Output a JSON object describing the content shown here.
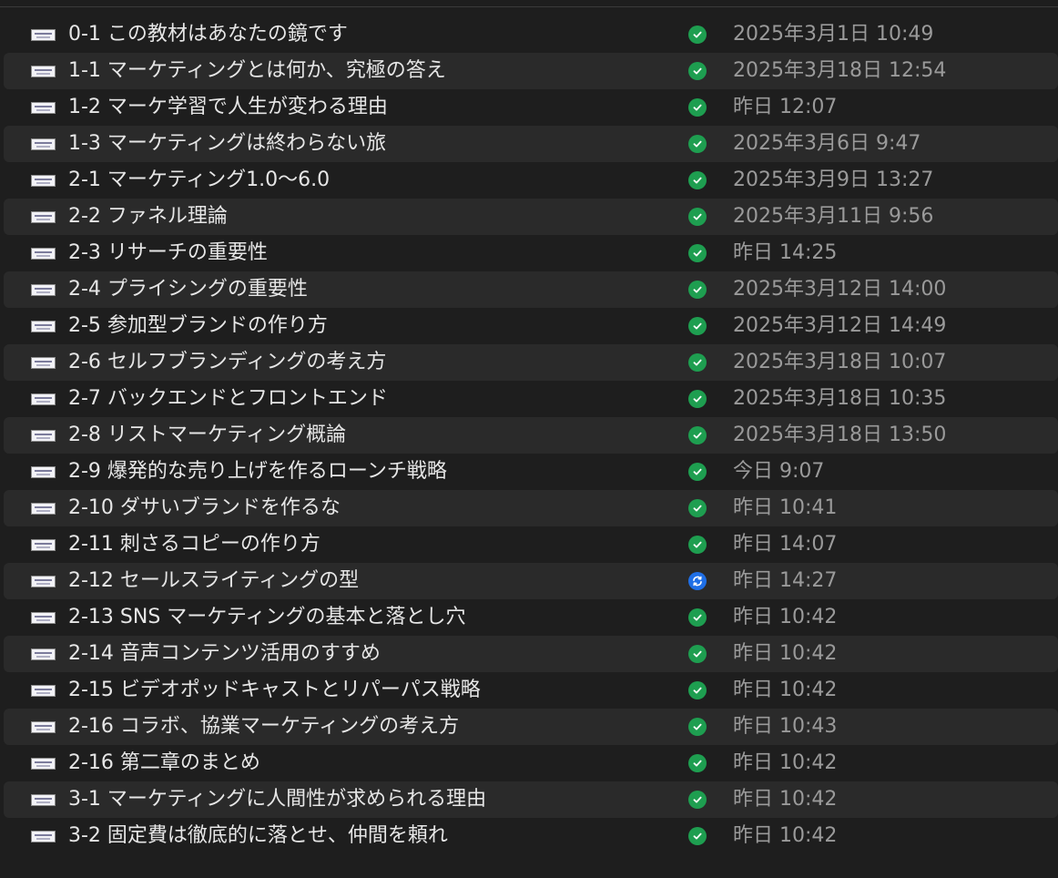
{
  "colors": {
    "background": "#1e1e1e",
    "alt_row": "#2a2a2a",
    "name_text": "#e6e6e6",
    "date_text": "#9a9a9a",
    "synced": "#1e9e50",
    "syncing": "#1f6fe6"
  },
  "files": [
    {
      "name": "0-1 この教材はあなたの鏡です",
      "status": "synced",
      "status_icon": "check-icon",
      "date": "2025年3月1日 10:49"
    },
    {
      "name": "1-1 マーケティングとは何か、究極の答え",
      "status": "synced",
      "status_icon": "check-icon",
      "date": "2025年3月18日 12:54"
    },
    {
      "name": "1-2 マーケ学習で人生が変わる理由",
      "status": "synced",
      "status_icon": "check-icon",
      "date": "昨日 12:07"
    },
    {
      "name": "1-3 マーケティングは終わらない旅",
      "status": "synced",
      "status_icon": "check-icon",
      "date": "2025年3月6日 9:47"
    },
    {
      "name": "2-1 マーケティング1.0～6.0",
      "status": "synced",
      "status_icon": "check-icon",
      "date": "2025年3月9日 13:27"
    },
    {
      "name": "2-2 ファネル理論",
      "status": "synced",
      "status_icon": "check-icon",
      "date": "2025年3月11日 9:56"
    },
    {
      "name": "2-3 リサーチの重要性",
      "status": "synced",
      "status_icon": "check-icon",
      "date": "昨日 14:25"
    },
    {
      "name": "2-4 プライシングの重要性",
      "status": "synced",
      "status_icon": "check-icon",
      "date": "2025年3月12日 14:00"
    },
    {
      "name": "2-5 参加型ブランドの作り方",
      "status": "synced",
      "status_icon": "check-icon",
      "date": "2025年3月12日 14:49"
    },
    {
      "name": "2-6 セルフブランディングの考え方",
      "status": "synced",
      "status_icon": "check-icon",
      "date": "2025年3月18日 10:07"
    },
    {
      "name": "2-7 バックエンドとフロントエンド",
      "status": "synced",
      "status_icon": "check-icon",
      "date": "2025年3月18日 10:35"
    },
    {
      "name": "2-8 リストマーケティング概論",
      "status": "synced",
      "status_icon": "check-icon",
      "date": "2025年3月18日 13:50"
    },
    {
      "name": "2-9 爆発的な売り上げを作るローンチ戦略",
      "status": "synced",
      "status_icon": "check-icon",
      "date": "今日 9:07"
    },
    {
      "name": "2-10 ダサいブランドを作るな",
      "status": "synced",
      "status_icon": "check-icon",
      "date": "昨日 10:41"
    },
    {
      "name": "2-11 刺さるコピーの作り方",
      "status": "synced",
      "status_icon": "check-icon",
      "date": "昨日 14:07"
    },
    {
      "name": "2-12 セールスライティングの型",
      "status": "syncing",
      "status_icon": "sync-icon",
      "date": "昨日 14:27"
    },
    {
      "name": "2-13 SNS マーケティングの基本と落とし穴",
      "status": "synced",
      "status_icon": "check-icon",
      "date": "昨日 10:42"
    },
    {
      "name": "2-14 音声コンテンツ活用のすすめ",
      "status": "synced",
      "status_icon": "check-icon",
      "date": "昨日 10:42"
    },
    {
      "name": "2-15 ビデオポッドキャストとリパーパス戦略",
      "status": "synced",
      "status_icon": "check-icon",
      "date": "昨日 10:42"
    },
    {
      "name": "2-16 コラボ、協業マーケティングの考え方",
      "status": "synced",
      "status_icon": "check-icon",
      "date": "昨日 10:43"
    },
    {
      "name": "2-16 第二章のまとめ",
      "status": "synced",
      "status_icon": "check-icon",
      "date": "昨日 10:42"
    },
    {
      "name": "3-1 マーケティングに人間性が求められる理由",
      "status": "synced",
      "status_icon": "check-icon",
      "date": "昨日 10:42"
    },
    {
      "name": "3-2 固定費は徹底的に落とせ、仲間を頼れ",
      "status": "synced",
      "status_icon": "check-icon",
      "date": "昨日 10:42"
    }
  ]
}
